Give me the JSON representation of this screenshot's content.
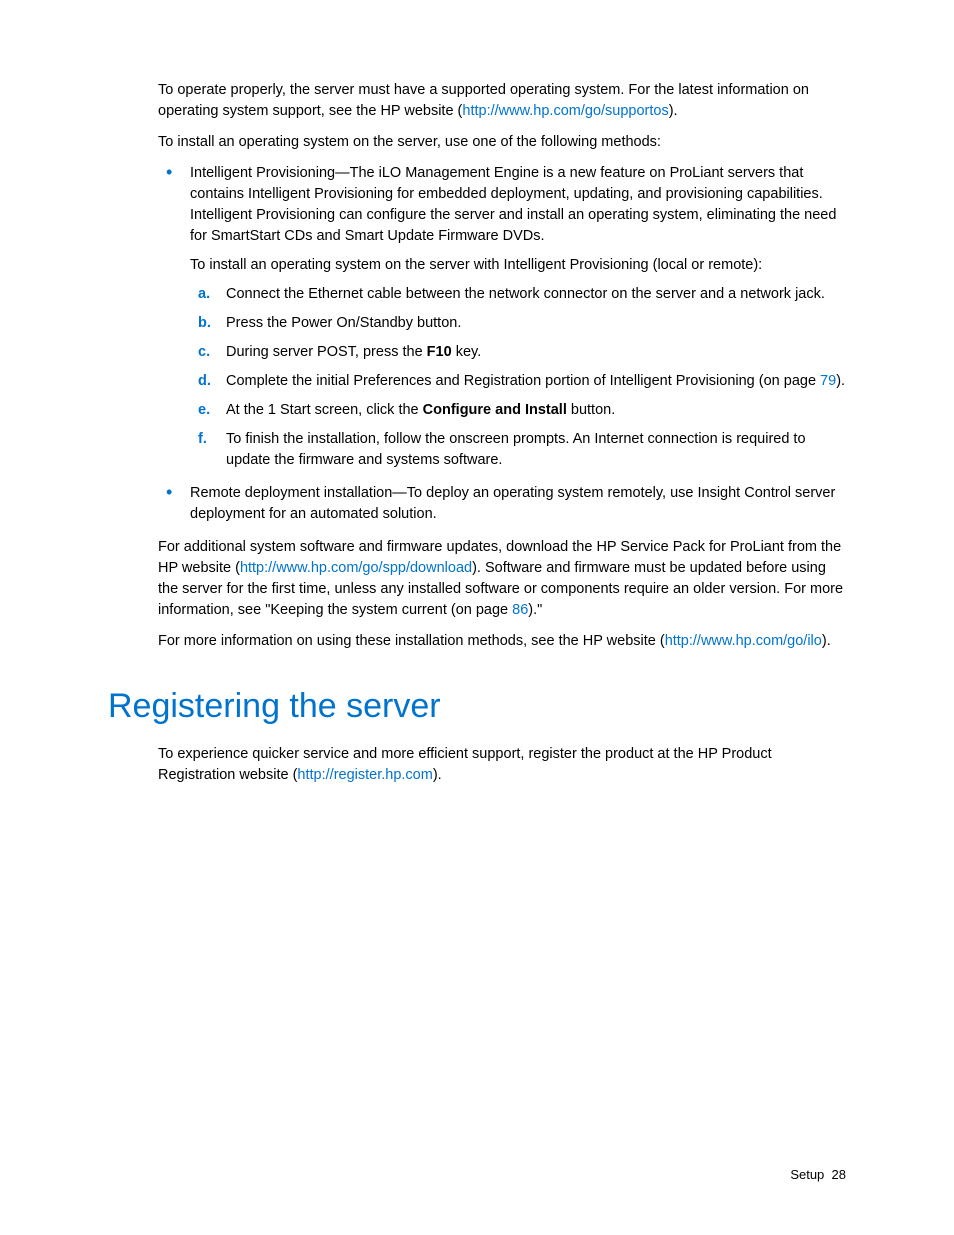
{
  "p1_a": "To operate properly, the server must have a supported operating system. For the latest information on operating system support, see the HP website (",
  "p1_link": "http://www.hp.com/go/supportos",
  "p1_b": ").",
  "p2": "To install an operating system on the server, use one of the following methods:",
  "bullet1_main": "Intelligent Provisioning—The iLO Management Engine is a new feature on ProLiant servers that contains Intelligent Provisioning for embedded deployment, updating, and provisioning capabilities. Intelligent Provisioning can configure the server and install an operating system, eliminating the need for SmartStart CDs and Smart Update Firmware DVDs.",
  "bullet1_sub": "To install an operating system on the server with Intelligent Provisioning (local or remote):",
  "step_a_m": "a.",
  "step_a": "Connect the Ethernet cable between the network connector on the server and a network jack.",
  "step_b_m": "b.",
  "step_b": "Press the Power On/Standby button.",
  "step_c_m": "c.",
  "step_c_1": "During server POST, press the ",
  "step_c_bold": "F10",
  "step_c_2": " key.",
  "step_d_m": "d.",
  "step_d_1": "Complete the initial Preferences and Registration portion of Intelligent Provisioning (on page ",
  "step_d_page": "79",
  "step_d_2": ").",
  "step_e_m": "e.",
  "step_e_1": "At the 1 Start screen, click the ",
  "step_e_bold": "Configure and Install",
  "step_e_2": " button.",
  "step_f_m": "f.",
  "step_f": "To finish the installation, follow the onscreen prompts. An Internet connection is required to update the firmware and systems software.",
  "bullet2": "Remote deployment installation—To deploy an operating system remotely, use Insight Control server deployment for an automated solution.",
  "p3_1": "For additional system software and firmware updates, download the HP Service Pack for ProLiant from the HP website (",
  "p3_link": "http://www.hp.com/go/spp/download",
  "p3_2": "). Software and firmware must be updated before using the server for the first time, unless any installed software or components require an older version. For more information, see \"Keeping the system current (on page ",
  "p3_page": "86",
  "p3_3": ").\"",
  "p4_1": "For more information on using these installation methods, see the HP website (",
  "p4_link": "http://www.hp.com/go/ilo",
  "p4_2": ").",
  "heading": "Registering the server",
  "p5_1": "To experience quicker service and more efficient support, register the product at the HP Product Registration website (",
  "p5_link": "http://register.hp.com",
  "p5_2": ").",
  "footer_section": "Setup",
  "footer_page": "28"
}
